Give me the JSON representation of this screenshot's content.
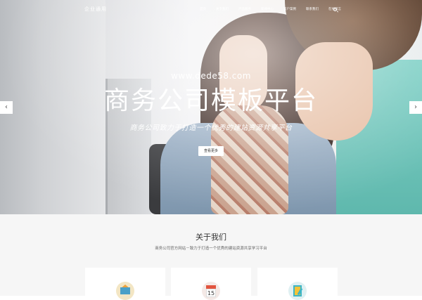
{
  "nav": {
    "logo": "企业通用",
    "items": [
      "首页",
      "关于我们",
      "产品服务",
      "新闻中心",
      "客户案例",
      "联系我们",
      "在线留言"
    ]
  },
  "hero": {
    "url": "www.dede58.com",
    "title": "商务公司模板平台",
    "subtitle": "商务公司致力于打造一个优秀的建站资源共享平台",
    "button_label": "查看更多",
    "prev_arrow": "‹",
    "next_arrow": "›"
  },
  "about": {
    "title": "关于我们",
    "description": "商务公司官方网站－致力于打造一个优秀的建站资源共享学习平台",
    "cards": [
      {
        "icon": "mail-icon"
      },
      {
        "icon": "calendar-icon",
        "calendar_day": "15"
      },
      {
        "icon": "note-icon"
      }
    ]
  },
  "colors": {
    "accent_teal": "#3db5c6",
    "accent_orange": "#f0a23a",
    "accent_red": "#e2543f",
    "section_bg": "#f6f6f6"
  }
}
